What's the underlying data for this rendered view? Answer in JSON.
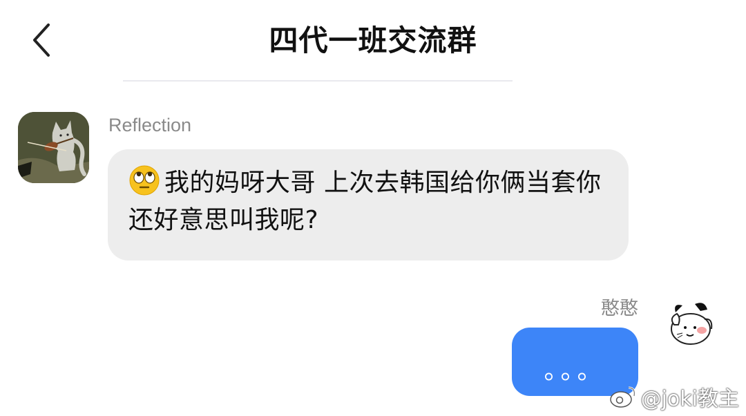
{
  "header": {
    "title": "四代一班交流群",
    "back_icon": "chevron-left-icon"
  },
  "messages": [
    {
      "side": "left",
      "sender": "Reflection",
      "avatar_icon": "cat-violin-avatar",
      "emoji": "eye-roll-emoji",
      "text": "我的妈呀大哥 上次去韩国给你俩当套你还好意思叫我呢?"
    },
    {
      "side": "right",
      "sender": "憨憨",
      "avatar_icon": "cartoon-dog-avatar",
      "text": "。。。"
    }
  ],
  "watermark": {
    "text": "@joki教主",
    "icon": "weibo-logo-icon"
  },
  "colors": {
    "bubble_left": "#ededed",
    "bubble_right": "#3d85f8",
    "name_gray": "#8a8a8a"
  }
}
